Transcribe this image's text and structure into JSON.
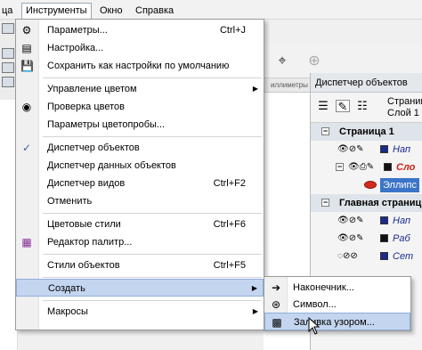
{
  "menubar": {
    "items": [
      "ца",
      "Инструменты",
      "Окно",
      "Справка"
    ]
  },
  "tools_menu": {
    "items": [
      {
        "label": "Параметры...",
        "shortcut": "Ctrl+J",
        "icon": "options-icon"
      },
      {
        "label": "Настройка...",
        "shortcut": "",
        "icon": "customize-icon"
      },
      {
        "label": "Сохранить как настройки по умолчанию",
        "shortcut": "",
        "icon": "save-defaults-icon"
      },
      {
        "label": "Управление цветом",
        "shortcut": "",
        "icon": "",
        "submenu": true
      },
      {
        "label": "Проверка цветов",
        "shortcut": "",
        "icon": "proof-colors-icon"
      },
      {
        "label": "Параметры цветопробы...",
        "shortcut": "",
        "icon": ""
      },
      {
        "label": "Диспетчер объектов",
        "shortcut": "",
        "icon": "checkmark-icon",
        "checked": true
      },
      {
        "label": "Диспетчер данных объектов",
        "shortcut": "",
        "icon": ""
      },
      {
        "label": "Диспетчер видов",
        "shortcut": "Ctrl+F2",
        "icon": ""
      },
      {
        "label": "Отменить",
        "shortcut": "",
        "icon": ""
      },
      {
        "label": "Цветовые стили",
        "shortcut": "Ctrl+F6",
        "icon": ""
      },
      {
        "label": "Редактор палитр...",
        "shortcut": "",
        "icon": "palette-editor-icon"
      },
      {
        "label": "Стили объектов",
        "shortcut": "Ctrl+F5",
        "icon": ""
      },
      {
        "label": "Создать",
        "shortcut": "",
        "icon": "",
        "submenu": true,
        "highlighted": true
      },
      {
        "label": "Макросы",
        "shortcut": "",
        "icon": "",
        "submenu": true
      }
    ]
  },
  "create_submenu": {
    "items": [
      {
        "label": "Наконечник...",
        "icon": "arrowhead-icon"
      },
      {
        "label": "Символ...",
        "icon": "symbol-icon"
      },
      {
        "label": "Заливка узором...",
        "icon": "pattern-fill-icon",
        "highlighted": true
      }
    ]
  },
  "ruler": {
    "unit_label": "иллиметры"
  },
  "docker": {
    "title": "Диспетчер объектов",
    "current_page": "Страниц",
    "current_layer": "Слой 1",
    "tree": [
      {
        "type": "page",
        "label": "Страница 1",
        "expander": "−"
      },
      {
        "type": "layer",
        "label": "Нап",
        "color": "#1a2a8a"
      },
      {
        "type": "layer",
        "label": "Сло",
        "color": "#111111",
        "text_color": "#cc1f14",
        "expander": "−"
      },
      {
        "type": "object",
        "label": "Эллипс"
      },
      {
        "type": "page",
        "label": "Главная страниц",
        "expander": "−"
      },
      {
        "type": "layer",
        "label": "Нап",
        "color": "#1a2a8a"
      },
      {
        "type": "layer",
        "label": "Раб",
        "color": "#111111"
      },
      {
        "type": "layer",
        "label": "Сет",
        "color": "#1a2a8a"
      }
    ]
  },
  "colors": {
    "highlight": "#c4d5ef",
    "highlight_border": "#90aedb",
    "selection_blue": "#3b74c8",
    "ellipse_red": "#d62a1e"
  }
}
